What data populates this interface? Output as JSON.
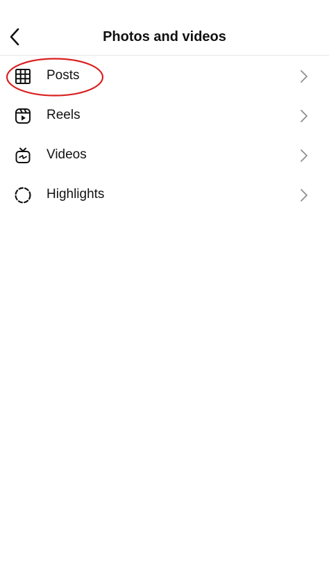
{
  "header": {
    "title": "Photos and videos",
    "back_icon": "chevron-left-icon"
  },
  "items": [
    {
      "label": "Posts",
      "icon": "grid-icon"
    },
    {
      "label": "Reels",
      "icon": "reels-icon"
    },
    {
      "label": "Videos",
      "icon": "tv-icon"
    },
    {
      "label": "Highlights",
      "icon": "dashed-circle-icon"
    }
  ],
  "annotation": {
    "type": "ellipse",
    "color": "#d9201f",
    "target": "Posts"
  },
  "colors": {
    "text": "#111111",
    "chevron": "#8e8e8e",
    "divider": "#e6e6e6"
  }
}
